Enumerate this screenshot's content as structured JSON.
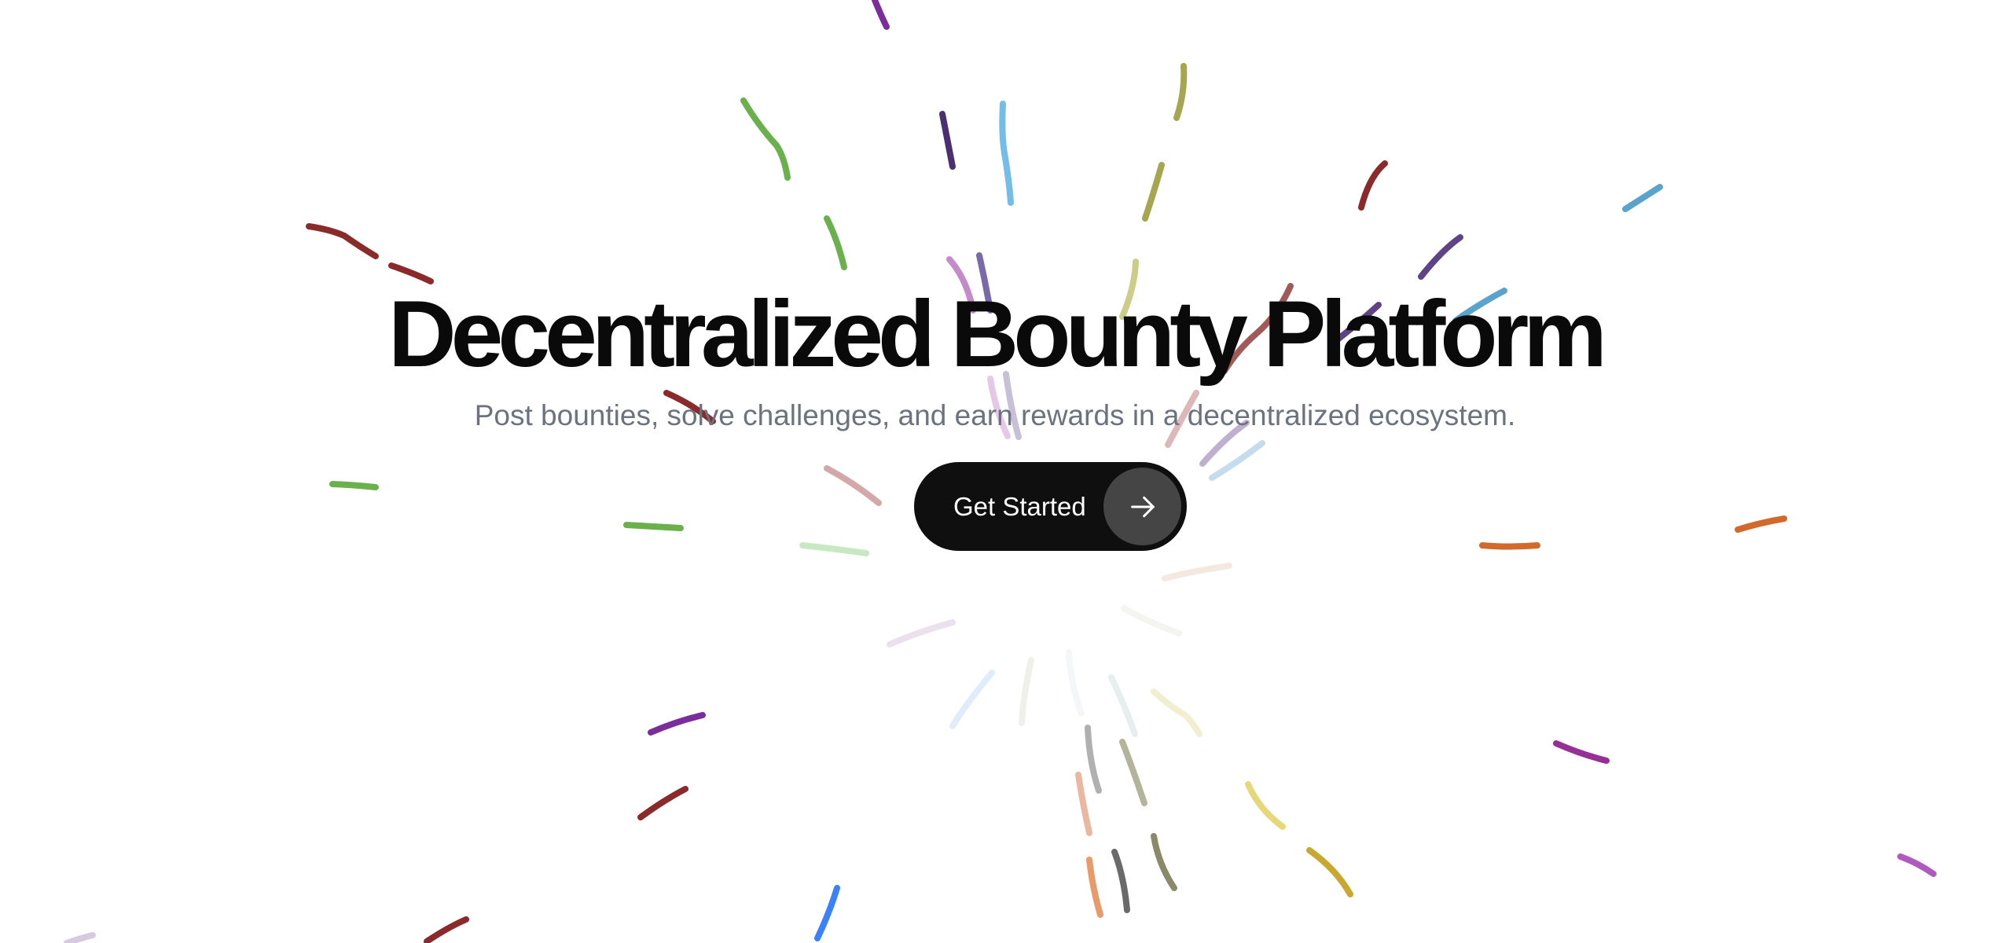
{
  "hero": {
    "title": "Decentralized Bounty Platform",
    "subtitle": "Post bounties, solve challenges, and earn rewards in a decentralized ecosystem."
  },
  "cta": {
    "label": "Get Started",
    "icon": "arrow-right-icon"
  },
  "colors": {
    "background": "#ffffff",
    "title": "#0a0a0a",
    "subtitle": "#6b7280",
    "button_bg": "#0f0f0f",
    "button_icon_bg": "#454545",
    "button_text": "#ffffff"
  },
  "decoration": {
    "type": "colored-streak-burst",
    "colors": [
      "#7b2d9b",
      "#6ab04c",
      "#4a3070",
      "#73bde6",
      "#a6a650",
      "#8b2a2a",
      "#5aa3cc",
      "#5e4487",
      "#c48ac9",
      "#d16a2c",
      "#3b82f6",
      "#c8a82f",
      "#e6d847"
    ]
  }
}
